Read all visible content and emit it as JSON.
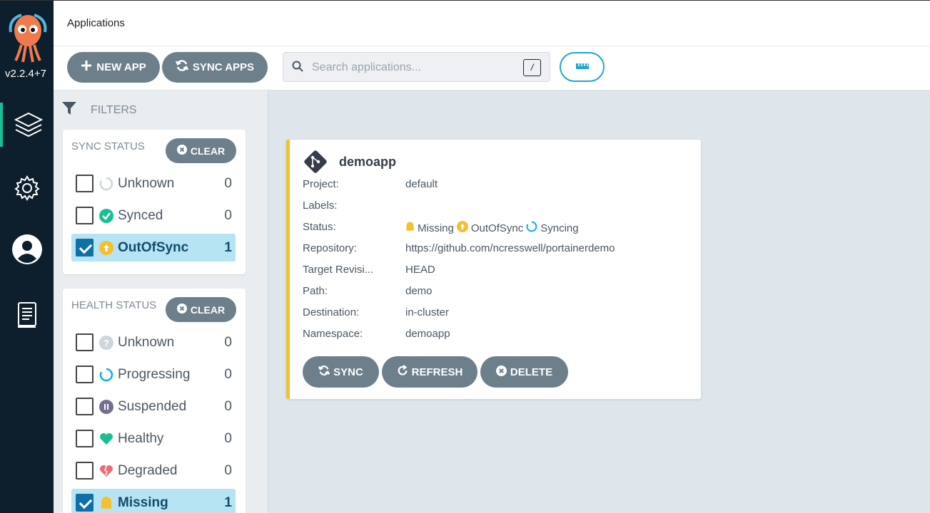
{
  "nav": {
    "version": "v2.2.4+7",
    "items": [
      {
        "name": "applications",
        "icon": "layers-icon",
        "active": true
      },
      {
        "name": "settings",
        "icon": "gear-icon",
        "active": false
      },
      {
        "name": "user-info",
        "icon": "user-icon",
        "active": false
      },
      {
        "name": "documentation",
        "icon": "docs-icon",
        "active": false
      }
    ]
  },
  "header": {
    "title": "Applications"
  },
  "toolbar": {
    "new_app": "NEW APP",
    "sync_apps": "SYNC APPS",
    "search_placeholder": "Search applications...",
    "search_shortcut": "/"
  },
  "filters": {
    "heading": "FILTERS",
    "sync_status": {
      "title": "SYNC STATUS",
      "clear": "CLEAR",
      "items": [
        {
          "label": "Unknown",
          "count": "0",
          "checked": false,
          "icon": "circle-notch-icon",
          "color": "#ccd6dd"
        },
        {
          "label": "Synced",
          "count": "0",
          "checked": false,
          "icon": "check-circle-icon",
          "color": "#18be94"
        },
        {
          "label": "OutOfSync",
          "count": "1",
          "checked": true,
          "icon": "arrow-up-circle-icon",
          "color": "#f4c030"
        }
      ]
    },
    "health_status": {
      "title": "HEALTH STATUS",
      "clear": "CLEAR",
      "items": [
        {
          "label": "Unknown",
          "count": "0",
          "checked": false,
          "icon": "question-circle-icon",
          "color": "#ccd6dd"
        },
        {
          "label": "Progressing",
          "count": "0",
          "checked": false,
          "icon": "progress-ring-icon",
          "color": "#0dadea"
        },
        {
          "label": "Suspended",
          "count": "0",
          "checked": false,
          "icon": "pause-circle-icon",
          "color": "#766f94"
        },
        {
          "label": "Healthy",
          "count": "0",
          "checked": false,
          "icon": "heart-icon",
          "color": "#18be94"
        },
        {
          "label": "Degraded",
          "count": "0",
          "checked": false,
          "icon": "broken-heart-icon",
          "color": "#e96d76"
        },
        {
          "label": "Missing",
          "count": "1",
          "checked": true,
          "icon": "ghost-icon",
          "color": "#f4c030"
        }
      ]
    }
  },
  "app_card": {
    "name": "demoapp",
    "fields": [
      {
        "key": "Project:",
        "value": "default"
      },
      {
        "key": "Labels:",
        "value": ""
      },
      {
        "key": "Status:",
        "value": ""
      },
      {
        "key": "Repository:",
        "value": "https://github.com/ncresswell/portainerdemo"
      },
      {
        "key": "Target Revisi...",
        "value": "HEAD"
      },
      {
        "key": "Path:",
        "value": "demo"
      },
      {
        "key": "Destination:",
        "value": "in-cluster"
      },
      {
        "key": "Namespace:",
        "value": "demoapp"
      }
    ],
    "status": {
      "health": "Missing",
      "sync": "OutOfSync",
      "operation": "Syncing"
    },
    "buttons": {
      "sync": "SYNC",
      "refresh": "REFRESH",
      "delete": "DELETE"
    },
    "accent_color": "#f4c030"
  }
}
